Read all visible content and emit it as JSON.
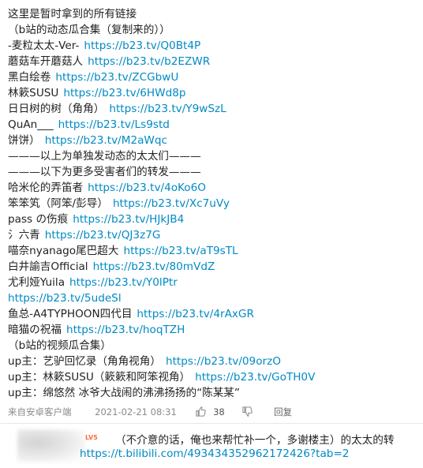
{
  "post": {
    "lines": [
      {
        "text": "这里是暂时拿到的所有链接",
        "link": ""
      },
      {
        "text": "（b站的动态瓜合集（复制来的））",
        "link": ""
      },
      {
        "text": "-麦粒太太-Ver-",
        "link": "https://b23.tv/Q0Bt4P"
      },
      {
        "text": "蘑菇车开蘑菇人",
        "link": "https://b23.tv/b2EZWR"
      },
      {
        "text": "黑白绘卷",
        "link": "https://b23.tv/ZCGbwU"
      },
      {
        "text": "林簌SUSU",
        "link": "https://b23.tv/6HWd8p"
      },
      {
        "text": "日日树的树（角角）",
        "link": "https://b23.tv/Y9wSzL"
      },
      {
        "text": "QuAn___",
        "link": "https://b23.tv/Ls9std"
      },
      {
        "text": "饼饼）",
        "link": "https://b23.tv/M2aWqc"
      },
      {
        "text": "———以上为单独发动态的太太们———",
        "link": ""
      },
      {
        "text": "———以下为更多受害者们的转发———",
        "link": ""
      },
      {
        "text": "哈米伦的弄笛者",
        "link": "https://b23.tv/4oKo6O"
      },
      {
        "text": "笨笨笂（阿笨/彭导）",
        "link": "https://b23.tv/Xc7uVy"
      },
      {
        "text": "pass の伤痕",
        "link": "https://b23.tv/HJkJB4"
      },
      {
        "text": "氵六青",
        "link": "https://b23.tv/QJ3z7G"
      },
      {
        "text": "喵奈nyanago尾巴超大",
        "link": "https://b23.tv/aT9sTL"
      },
      {
        "text": "白井諭吉Official",
        "link": "https://b23.tv/80mVdZ"
      },
      {
        "text": "尤利娅Yuila",
        "link": "https://b23.tv/Y0lPtr"
      },
      {
        "text": "",
        "link": "https://b23.tv/5udeSl"
      },
      {
        "text": "鱼总-A4TYPHOON四代目",
        "link": "https://b23.tv/4rAxGR"
      },
      {
        "text": "暗猫の祝福",
        "link": "https://b23.tv/hoqTZH"
      },
      {
        "text": "（b站的视频瓜合集）",
        "link": ""
      },
      {
        "text": "up主：艺驴回忆录（角角视角）",
        "link": "https://b23.tv/09orzO"
      },
      {
        "text": "up主：林簌SUSU（簌簌和阿笨视角）",
        "link": "https://b23.tv/GoTH0V"
      },
      {
        "text": "up主：绵悠然 冰爷大战闹的沸沸扬扬的“陈某某”",
        "link": ""
      }
    ]
  },
  "meta": {
    "client": "来自安卓客户端",
    "timestamp": "2021-02-21 08:31",
    "like_count": "38",
    "reply_label": "回复",
    "icons": [
      "thumbs-up-icon",
      "thumbs-down-icon"
    ]
  },
  "comment": {
    "level_badge": "LV5",
    "text": "（不介意的话，俺也来帮忙补一个，多谢楼主）的太太的转",
    "link": "https://t.bilibili.com/493434352962172426?tab=2"
  },
  "colors": {
    "link": "#008ac5",
    "text": "#222222",
    "meta": "#8a8a8a",
    "badge": "#ff6a3d"
  }
}
